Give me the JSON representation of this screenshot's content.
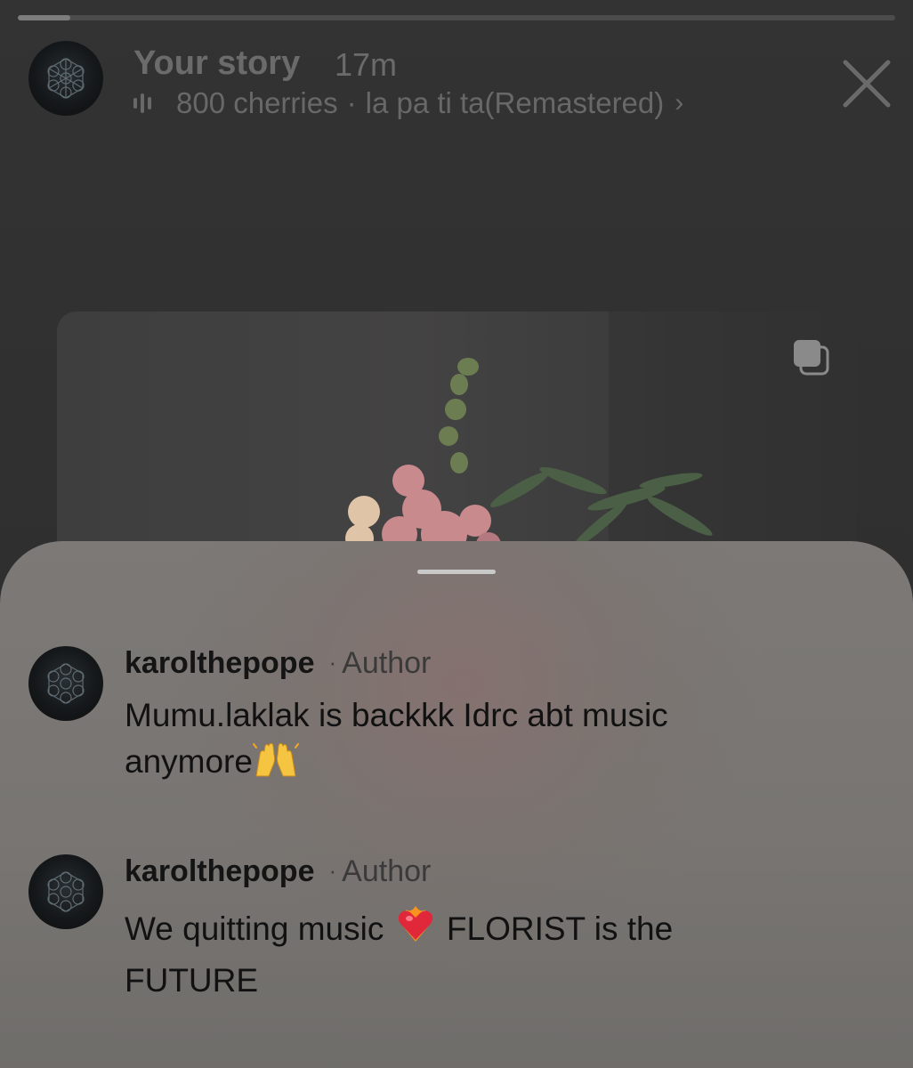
{
  "story": {
    "progress": 0.06,
    "title": "Your story",
    "time": "17m",
    "music": {
      "artist": "800 cherries",
      "separator": "·",
      "track": "la pa ti ta(Remastered)",
      "chevron": "›"
    },
    "icons": {
      "avatar": "metatron-cube-avatar",
      "music": "equalizer-icon",
      "close": "close-icon",
      "multi_media": "multiple-pages-icon"
    }
  },
  "comments": [
    {
      "username": "karolthepope",
      "separator": "·",
      "role": "Author",
      "text": "Mumu.laklak is backkk Idrc abt music anymore",
      "emoji": "raising-hands"
    },
    {
      "username": "karolthepope",
      "separator": "·",
      "role": "Author",
      "text_before": "We quitting music ",
      "text_after": " FLORIST is the FUTURE",
      "emoji": "heart-on-fire"
    }
  ],
  "colors": {
    "background": "#2f2f2f",
    "sheet": "#7a7775",
    "username": "#141414",
    "muted": "#6b6b6b"
  }
}
